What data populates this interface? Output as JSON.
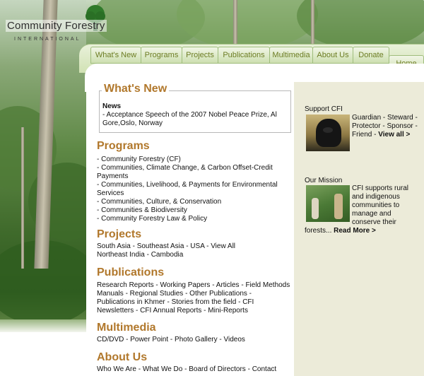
{
  "brand": {
    "title": "Community Forestry",
    "subtitle": "INTERNATIONAL"
  },
  "nav": [
    {
      "label": "What's New"
    },
    {
      "label": "Programs"
    },
    {
      "label": "Projects"
    },
    {
      "label": "Publications"
    },
    {
      "label": "Multimedia"
    },
    {
      "label": "About Us"
    },
    {
      "label": "Donate"
    },
    {
      "label": "Home"
    }
  ],
  "whats_new": {
    "heading": "What's New",
    "label": "News",
    "text": "- Acceptance Speech of the 2007 Nobel Peace Prize, Al Gore,Oslo, Norway"
  },
  "programs": {
    "heading": "Programs",
    "items": [
      "- Community Forestry (CF)",
      "- Communities, Climate Change, & Carbon Offset-Credit Payments",
      "- Communities, Livelihood, & Payments for Environmental Services",
      "- Communities, Culture, & Conservation",
      "- Communities & Biodiversity",
      "- Community Forestry Law & Policy"
    ]
  },
  "projects": {
    "heading": "Projects",
    "line1": "South Asia - Southeast Asia - USA - View All",
    "line2": "Northeast India - Cambodia"
  },
  "publications": {
    "heading": "Publications",
    "text": "Research Reports - Working Papers - Articles - Field Methods Manuals - Regional Studies - Other Publications - Publications in Khmer - Stories from the field - CFI Newsletters - CFI Annual Reports - Mini-Reports"
  },
  "multimedia": {
    "heading": "Multimedia",
    "text": "CD/DVD - Power Point - Photo Gallery - Videos"
  },
  "about": {
    "heading": "About Us",
    "text": "Who We Are - What We Do - Board of Directors - Contact"
  },
  "sidebar": {
    "support_label": "Support CFI",
    "support_text": "Guardian - Steward - Protector - Sponsor - Friend - ",
    "support_link": "View all >",
    "mission_label": "Our Mission",
    "mission_text": "CFI supports rural and indigenous communities to manage and conserve their forests... ",
    "mission_link": "Read More >"
  }
}
